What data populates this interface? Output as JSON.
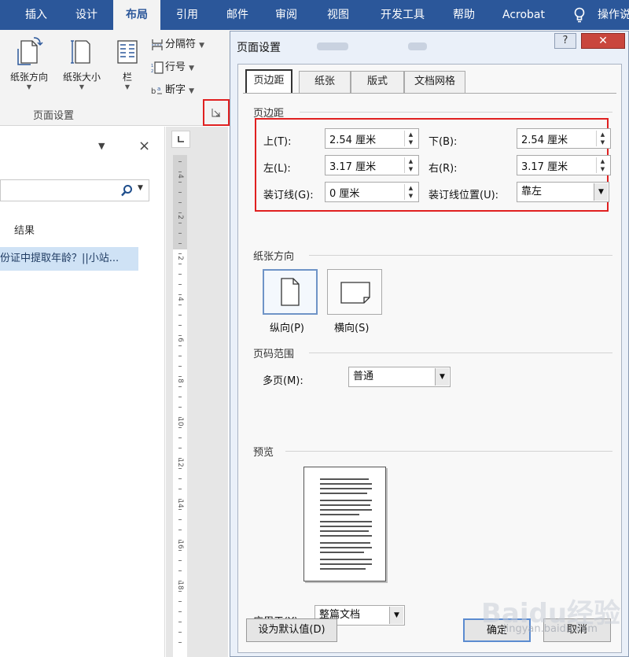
{
  "ribbon": {
    "tabs": [
      {
        "label": "插入",
        "active": false
      },
      {
        "label": "设计",
        "active": false
      },
      {
        "label": "布局",
        "active": true
      },
      {
        "label": "引用",
        "active": false
      },
      {
        "label": "邮件",
        "active": false
      },
      {
        "label": "审阅",
        "active": false
      },
      {
        "label": "视图",
        "active": false
      },
      {
        "label": "开发工具",
        "active": false
      },
      {
        "label": "帮助",
        "active": false
      },
      {
        "label": "Acrobat",
        "active": false
      }
    ],
    "tell_me": "操作说",
    "orientation_label": "纸张方向",
    "size_label": "纸张大小",
    "columns_label": "栏",
    "breaks_label": "分隔符",
    "line_numbers_label": "行号",
    "hyphenation_label": "断字",
    "group_label": "页面设置",
    "colors": {
      "tab_bar": "#2b579a",
      "ribbon": "#f3f3f3",
      "highlight": "#e02020"
    }
  },
  "nav_pane": {
    "dropdown": "▼",
    "close": "×",
    "search_value": "",
    "results_tab": "结果",
    "result_item": "份证中提取年龄？||小站..."
  },
  "ruler": {
    "labels": [
      "4",
      "2",
      "2",
      "4",
      "6",
      "8",
      "10",
      "12",
      "14",
      "16",
      "18"
    ]
  },
  "dialog": {
    "title": "页面设置",
    "help": "?",
    "close": "✕",
    "tabs": [
      {
        "label": "页边距",
        "active": true
      },
      {
        "label": "纸张",
        "active": false
      },
      {
        "label": "版式",
        "active": false
      },
      {
        "label": "文档网格",
        "active": false
      }
    ],
    "margins": {
      "section": "页边距",
      "top_label": "上(T):",
      "top_value": "2.54 厘米",
      "bottom_label": "下(B):",
      "bottom_value": "2.54 厘米",
      "left_label": "左(L):",
      "left_value": "3.17 厘米",
      "right_label": "右(R):",
      "right_value": "3.17 厘米",
      "gutter_label": "装订线(G):",
      "gutter_value": "0 厘米",
      "gutter_pos_label": "装订线位置(U):",
      "gutter_pos_value": "靠左"
    },
    "orientation": {
      "section": "纸张方向",
      "portrait": "纵向(P)",
      "landscape": "横向(S)",
      "selected": "portrait"
    },
    "pages": {
      "section": "页码范围",
      "multiple_label": "多页(M):",
      "multiple_value": "普通"
    },
    "preview": {
      "section": "预览"
    },
    "apply": {
      "label": "应用于(Y):",
      "value": "整篇文档"
    },
    "buttons": {
      "default": "设为默认值(D)",
      "ok": "确定",
      "cancel": "取消"
    }
  },
  "watermark": {
    "brand": "Baidu经验",
    "url": "jingyan.baidu.com"
  }
}
